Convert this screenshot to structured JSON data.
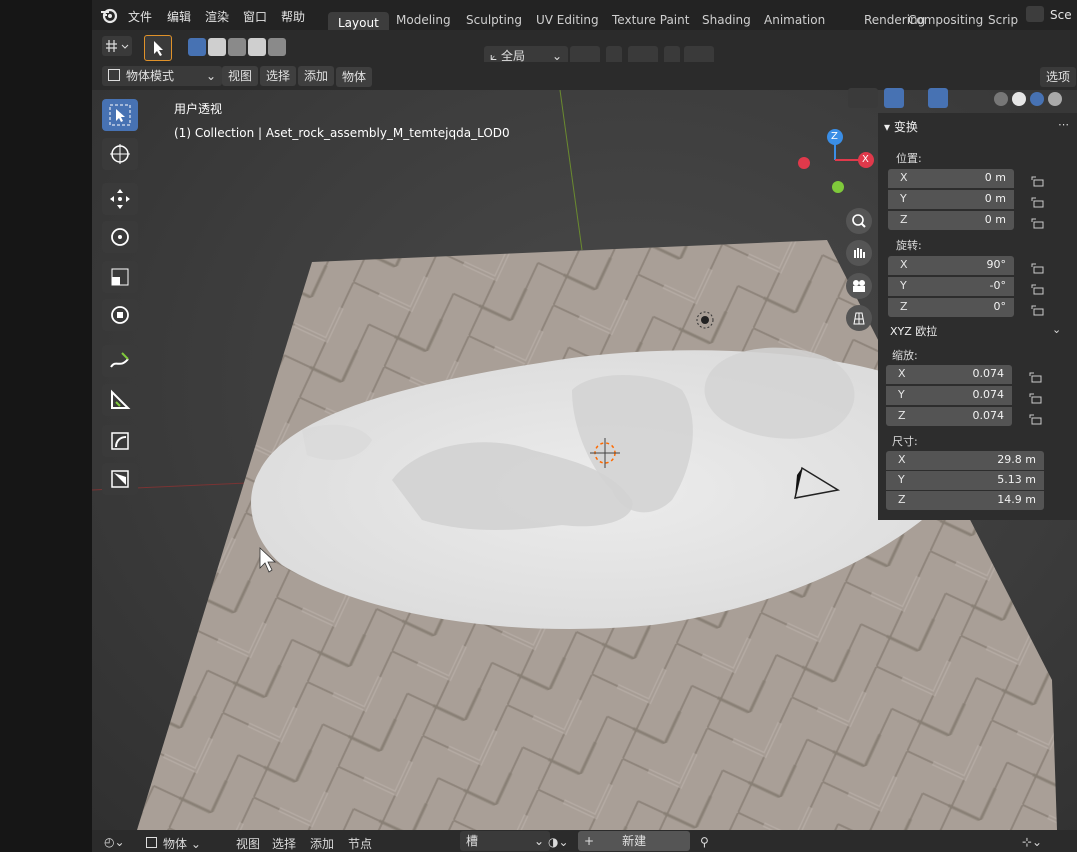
{
  "menu": {
    "items": [
      "文件",
      "编辑",
      "渲染",
      "窗口",
      "帮助"
    ]
  },
  "workspaces": {
    "tabs": [
      "Layout",
      "Modeling",
      "Sculpting",
      "UV Editing",
      "Texture Paint",
      "Shading",
      "Animation",
      "Rendering",
      "Compositing",
      "Scrip"
    ],
    "active": "Layout",
    "scene_label": "Sce"
  },
  "header": {
    "mode": "物体模式",
    "menus": [
      "视图",
      "选择",
      "添加",
      "物体"
    ],
    "orientation": "全局",
    "options_label": "选项"
  },
  "viewport": {
    "view_name": "用户透视",
    "collection_info": "(1) Collection | Aset_rock_assembly_M_temtejqda_LOD0"
  },
  "transform_panel": {
    "title": "变换",
    "location_label": "位置:",
    "location": [
      {
        "axis": "X",
        "value": "0 m"
      },
      {
        "axis": "Y",
        "value": "0 m"
      },
      {
        "axis": "Z",
        "value": "0 m"
      }
    ],
    "rotation_label": "旋转:",
    "rotation": [
      {
        "axis": "X",
        "value": "90°"
      },
      {
        "axis": "Y",
        "value": "-0°"
      },
      {
        "axis": "Z",
        "value": "0°"
      }
    ],
    "rotation_mode": "XYZ 欧拉",
    "scale_label": "缩放:",
    "scale": [
      {
        "axis": "X",
        "value": "0.074"
      },
      {
        "axis": "Y",
        "value": "0.074"
      },
      {
        "axis": "Z",
        "value": "0.074"
      }
    ],
    "dimensions_label": "尺寸:",
    "dimensions": [
      {
        "axis": "X",
        "value": "29.8 m"
      },
      {
        "axis": "Y",
        "value": "5.13 m"
      },
      {
        "axis": "Z",
        "value": "14.9 m"
      }
    ]
  },
  "bottom_bar": {
    "mode": "物体",
    "menus": [
      "视图",
      "选择",
      "添加",
      "节点"
    ],
    "slot": "槽",
    "new_label": "新建"
  },
  "gizmo": {
    "z": "Z",
    "x": "X"
  },
  "colors": {
    "accent": "#4772b3",
    "axis_x": "#e0394b",
    "axis_y": "#7fc93b",
    "axis_z": "#3a8ee6"
  }
}
